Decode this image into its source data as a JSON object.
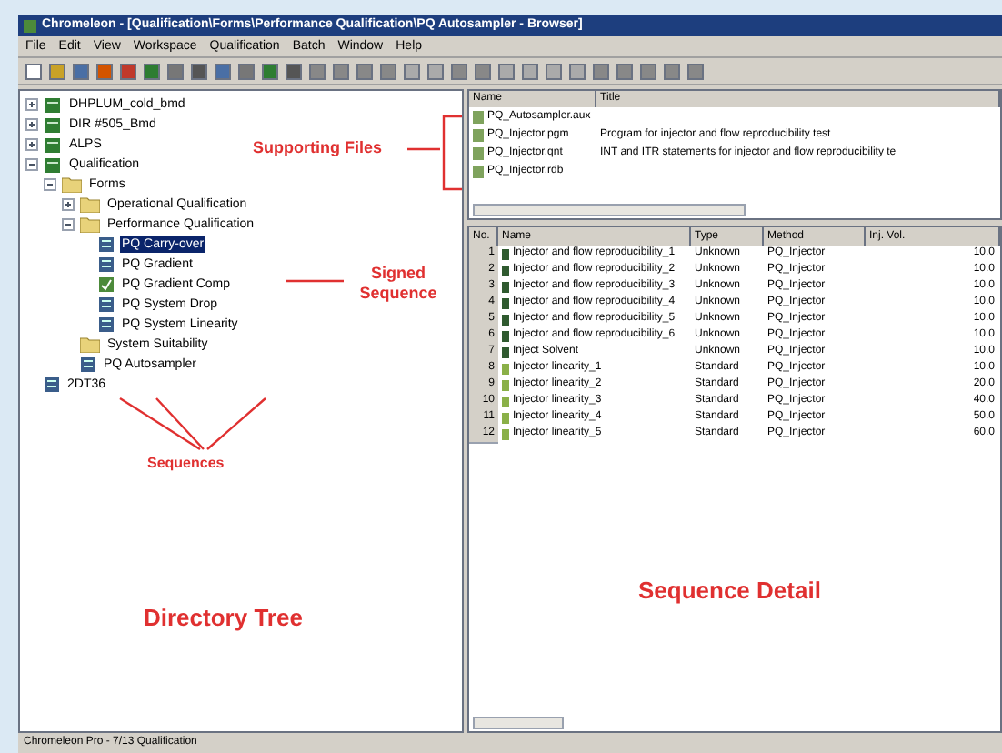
{
  "window": {
    "title": "Chromeleon - [Qualification\\Forms\\Performance Qualification\\PQ Autosampler - Browser]"
  },
  "menu": [
    "File",
    "Edit",
    "View",
    "Workspace",
    "Qualification",
    "Batch",
    "Window",
    "Help"
  ],
  "tree": [
    {
      "label": "DHPLUM_cold_bmd",
      "kind": "server",
      "expanded": false,
      "selected": false
    },
    {
      "label": "DIR #505_Bmd",
      "kind": "server",
      "expanded": false,
      "selected": false
    },
    {
      "label": "ALPS",
      "kind": "server",
      "expanded": false,
      "selected": false
    },
    {
      "label": "Qualification",
      "kind": "server",
      "expanded": true,
      "selected": false,
      "children": [
        {
          "label": "Forms",
          "kind": "folder",
          "expanded": true,
          "selected": false,
          "children": [
            {
              "label": "Operational Qualification",
              "kind": "folder",
              "expanded": false,
              "selected": false
            },
            {
              "label": "Performance Qualification",
              "kind": "folder",
              "expanded": true,
              "selected": false,
              "children": [
                {
                  "label": "PQ Carry-over",
                  "kind": "sequence",
                  "selected": true
                },
                {
                  "label": "PQ Gradient",
                  "kind": "sequence",
                  "selected": false
                },
                {
                  "label": "PQ Gradient Comp",
                  "kind": "signed",
                  "selected": false
                },
                {
                  "label": "PQ System Drop",
                  "kind": "sequence",
                  "selected": false
                },
                {
                  "label": "PQ System Linearity",
                  "kind": "sequence",
                  "selected": false
                }
              ]
            },
            {
              "label": "System Suitability",
              "kind": "folder",
              "selected": false
            },
            {
              "label": "PQ Autosampler",
              "kind": "sequence",
              "selected": false
            }
          ]
        }
      ]
    },
    {
      "label": "2DT36",
      "kind": "sequence",
      "selected": false
    }
  ],
  "annotations": {
    "supporting_files": "Supporting Files",
    "signed_sequence": "Signed Sequence",
    "sequences": "Sequences",
    "directory_tree": "Directory Tree",
    "sequence_detail": "Sequence Detail"
  },
  "files": {
    "columns": [
      "Name",
      "Title"
    ],
    "rows": [
      {
        "name": "PQ_Autosampler.aux",
        "title": ""
      },
      {
        "name": "PQ_Injector.pgm",
        "title": "Program for injector and flow reproducibility test"
      },
      {
        "name": "PQ_Injector.qnt",
        "title": "INT and ITR statements for injector and flow reproducibility te"
      },
      {
        "name": "PQ_Injector.rdb",
        "title": ""
      }
    ]
  },
  "samples": {
    "columns": [
      "No.",
      "Name",
      "Type",
      "Method",
      "Inj. Vol."
    ],
    "rows": [
      {
        "no": "1",
        "name": "Injector and flow reproducibility_1",
        "type": "Unknown",
        "method": "PQ_Injector",
        "vol": "10.0",
        "kind": "unknown"
      },
      {
        "no": "2",
        "name": "Injector and flow reproducibility_2",
        "type": "Unknown",
        "method": "PQ_Injector",
        "vol": "10.0",
        "kind": "unknown"
      },
      {
        "no": "3",
        "name": "Injector and flow reproducibility_3",
        "type": "Unknown",
        "method": "PQ_Injector",
        "vol": "10.0",
        "kind": "unknown"
      },
      {
        "no": "4",
        "name": "Injector and flow reproducibility_4",
        "type": "Unknown",
        "method": "PQ_Injector",
        "vol": "10.0",
        "kind": "unknown"
      },
      {
        "no": "5",
        "name": "Injector and flow reproducibility_5",
        "type": "Unknown",
        "method": "PQ_Injector",
        "vol": "10.0",
        "kind": "unknown"
      },
      {
        "no": "6",
        "name": "Injector and flow reproducibility_6",
        "type": "Unknown",
        "method": "PQ_Injector",
        "vol": "10.0",
        "kind": "unknown"
      },
      {
        "no": "7",
        "name": "Inject Solvent",
        "type": "Unknown",
        "method": "PQ_Injector",
        "vol": "10.0",
        "kind": "unknown"
      },
      {
        "no": "8",
        "name": "Injector linearity_1",
        "type": "Standard",
        "method": "PQ_Injector",
        "vol": "10.0",
        "kind": "standard"
      },
      {
        "no": "9",
        "name": "Injector linearity_2",
        "type": "Standard",
        "method": "PQ_Injector",
        "vol": "20.0",
        "kind": "standard"
      },
      {
        "no": "10",
        "name": "Injector linearity_3",
        "type": "Standard",
        "method": "PQ_Injector",
        "vol": "40.0",
        "kind": "standard"
      },
      {
        "no": "11",
        "name": "Injector linearity_4",
        "type": "Standard",
        "method": "PQ_Injector",
        "vol": "50.0",
        "kind": "standard"
      },
      {
        "no": "12",
        "name": "Injector linearity_5",
        "type": "Standard",
        "method": "PQ_Injector",
        "vol": "60.0",
        "kind": "standard"
      }
    ]
  },
  "status_bar": {
    "text": "Chromeleon Pro - 7/13 Qualification"
  }
}
